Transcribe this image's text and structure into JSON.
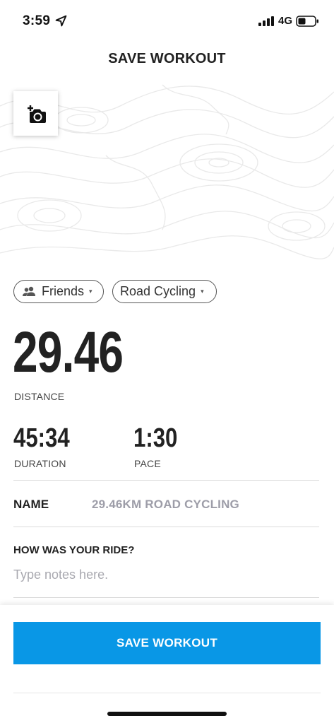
{
  "status_bar": {
    "time": "3:59",
    "network": "4G",
    "icons": [
      "location-arrow-icon",
      "signal-icon",
      "battery-icon"
    ]
  },
  "header": {
    "title": "SAVE WORKOUT"
  },
  "media": {
    "add_photo_icon": "add-photo-icon"
  },
  "chips": {
    "privacy": {
      "label": "Friends",
      "icon": "people-icon"
    },
    "sport": {
      "label": "Road Cycling"
    },
    "caret_glyph": "▾"
  },
  "stats": {
    "distance": {
      "value": "29.46",
      "label": "DISTANCE"
    },
    "duration": {
      "value": "45:34",
      "label": "DURATION"
    },
    "pace": {
      "value": "1:30",
      "label": "PACE"
    }
  },
  "name": {
    "label": "NAME",
    "value": "29.46KM ROAD CYCLING"
  },
  "notes": {
    "label": "HOW WAS YOUR RIDE?",
    "placeholder": "Type notes here.",
    "value": ""
  },
  "footer": {
    "save_label": "SAVE WORKOUT"
  },
  "colors": {
    "accent": "#0997e6",
    "name_value": "#9d9da8",
    "topo_lines": "#e9e9e9"
  }
}
